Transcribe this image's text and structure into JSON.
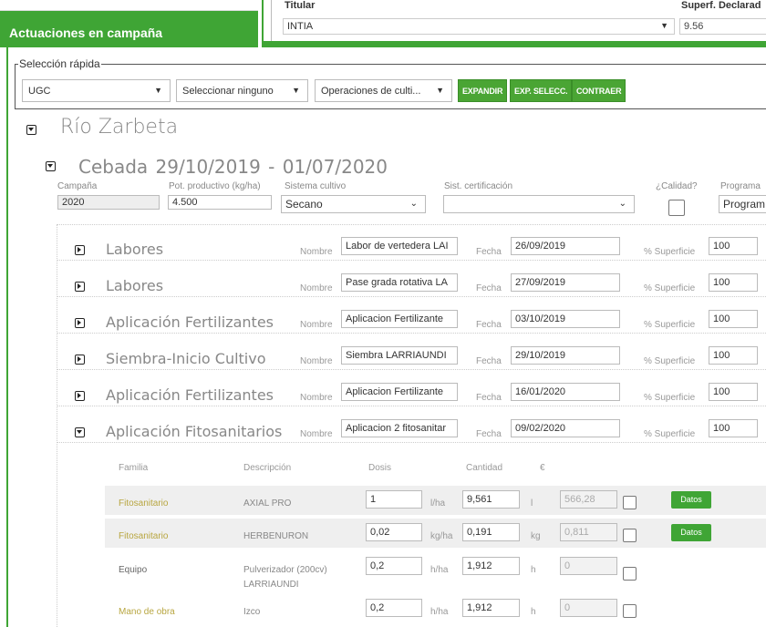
{
  "header": {
    "section_title": "Actuaciones en campaña",
    "titular_label": "Titular",
    "titular_value": "INTIA",
    "superficie_label": "Superf. Declarad",
    "superficie_value": "9.56"
  },
  "quick_selection": {
    "legend": "Selección rápida",
    "select1": "UGC",
    "select2": "Seleccionar ninguno",
    "select3": "Operaciones de culti...",
    "buttons": [
      "EXPANDIR",
      "EXP. SELECC.",
      "CONTRAER"
    ]
  },
  "parcel": {
    "name": "Río Zarbeta"
  },
  "crop": {
    "title": "Cebada 29/10/2019  -  01/07/2020",
    "campana_label": "Campaña",
    "campana_value": "2020",
    "potencial_label": "Pot. productivo (kg/ha)",
    "potencial_value": "4.500",
    "sistema_label": "Sistema cultivo",
    "sistema_value": "Secano",
    "certificacion_label": "Sist. certificación",
    "certificacion_value": "",
    "calidad_label": "¿Calidad?",
    "programa_label": "Programa",
    "programa_value": "Program"
  },
  "labels": {
    "nombre": "Nombre",
    "fecha": "Fecha",
    "superficie": "% Superficie"
  },
  "tasks": [
    {
      "title": "Labores",
      "nombre": "Labor de vertedera LAI",
      "fecha": "26/09/2019",
      "superficie": "100",
      "expanded": false
    },
    {
      "title": "Labores",
      "nombre": "Pase grada rotativa LA",
      "fecha": "27/09/2019",
      "superficie": "100",
      "expanded": false
    },
    {
      "title": "Aplicación Fertilizantes",
      "nombre": "Aplicacion Fertilizante",
      "fecha": "03/10/2019",
      "superficie": "100",
      "expanded": false
    },
    {
      "title": "Siembra-Inicio Cultivo",
      "nombre": "Siembra LARRIAUNDI",
      "fecha": "29/10/2019",
      "superficie": "100",
      "expanded": false
    },
    {
      "title": "Aplicación Fertilizantes",
      "nombre": "Aplicacion Fertilizante",
      "fecha": "16/01/2020",
      "superficie": "100",
      "expanded": false
    },
    {
      "title": "Aplicación Fitosanitarios",
      "nombre": "Aplicacion 2 fitosanitar",
      "fecha": "09/02/2020",
      "superficie": "100",
      "expanded": true
    }
  ],
  "products_header": {
    "familia": "Familia",
    "descripcion": "Descripción",
    "dosis": "Dosis",
    "cantidad": "Cantidad",
    "euro": "€"
  },
  "products": [
    {
      "familia": "Fitosanitario",
      "descripcion": "AXIAL PRO",
      "dosis": "1",
      "dosis_unit": "l/ha",
      "cantidad": "9,561",
      "cantidad_unit": "l",
      "euro": "566,28",
      "datos": "Datos"
    },
    {
      "familia": "Fitosanitario",
      "descripcion": "HERBENURON",
      "dosis": "0,02",
      "dosis_unit": "kg/ha",
      "cantidad": "0,191",
      "cantidad_unit": "kg",
      "euro": "0,811",
      "datos": "Datos"
    },
    {
      "familia": "Equipo",
      "descripcion_line1": "Pulverizador (200cv)",
      "descripcion_line2": "LARRIAUNDI",
      "dosis": "0,2",
      "dosis_unit": "h/ha",
      "cantidad": "1,912",
      "cantidad_unit": "h",
      "euro": "0"
    },
    {
      "familia": "Mano de obra",
      "descripcion": "Izco",
      "dosis": "0,2",
      "dosis_unit": "h/ha",
      "cantidad": "1,912",
      "cantidad_unit": "h",
      "euro": "0"
    }
  ],
  "colors": {
    "brand_green": "#3fa535",
    "family_gold": "#b8a640"
  }
}
